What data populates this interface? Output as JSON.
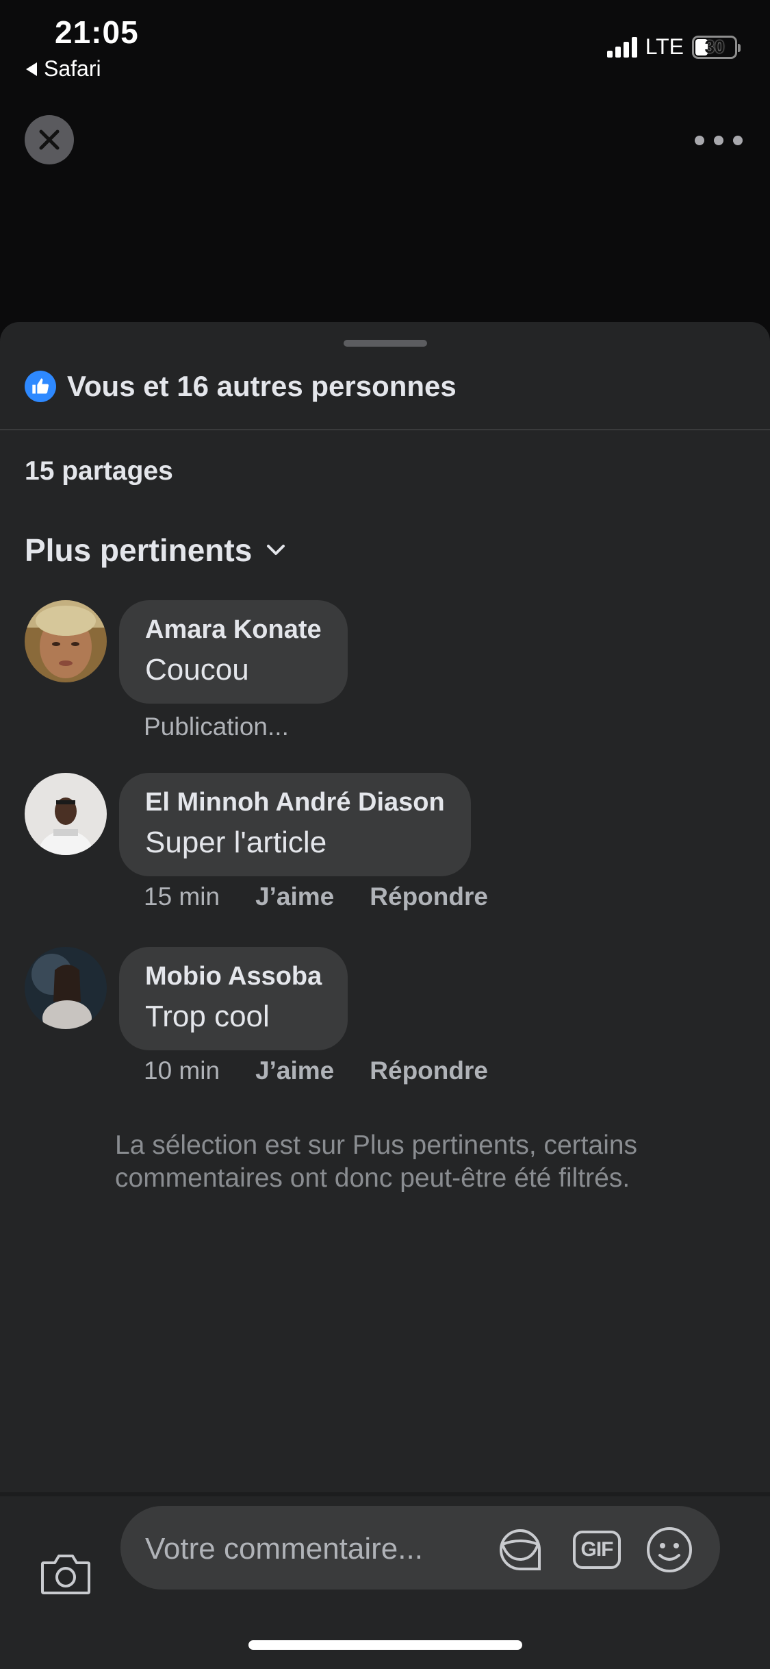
{
  "status_bar": {
    "time": "21:05",
    "back_label": "Safari",
    "network": "LTE",
    "battery_level": "30",
    "battery_fraction": 0.3
  },
  "top_bar": {
    "close_icon": "close-icon",
    "more_icon": "more-horizontal-icon"
  },
  "reactions": {
    "icon": "like-icon",
    "color": "#2e89ff",
    "text": "Vous et 16 autres personnes"
  },
  "shares": "15 partages",
  "sort": {
    "label": "Plus pertinents",
    "icon": "chevron-down-icon"
  },
  "comments": [
    {
      "name": "Amara Konate",
      "text": "Coucou",
      "status": "Publication..."
    },
    {
      "name": "El Minnoh André Diason",
      "text": "Super l'article",
      "time": "15 min",
      "like_label": "J’aime",
      "reply_label": "Répondre"
    },
    {
      "name": "Mobio Assoba",
      "text": "Trop cool",
      "time": "10 min",
      "like_label": "J’aime",
      "reply_label": "Répondre"
    }
  ],
  "filter_note": "La sélection est sur Plus pertinents, certains commentaires ont donc peut-être été filtrés.",
  "composer": {
    "camera_icon": "camera-icon",
    "placeholder": "Votre commentaire...",
    "sticker_icon": "sticker-icon",
    "gif_label": "GIF",
    "emoji_icon": "emoji-icon"
  },
  "colors": {
    "background": "#0b0b0c",
    "sheet": "#242526",
    "bubble": "#3a3b3c",
    "accent": "#2e89ff"
  }
}
